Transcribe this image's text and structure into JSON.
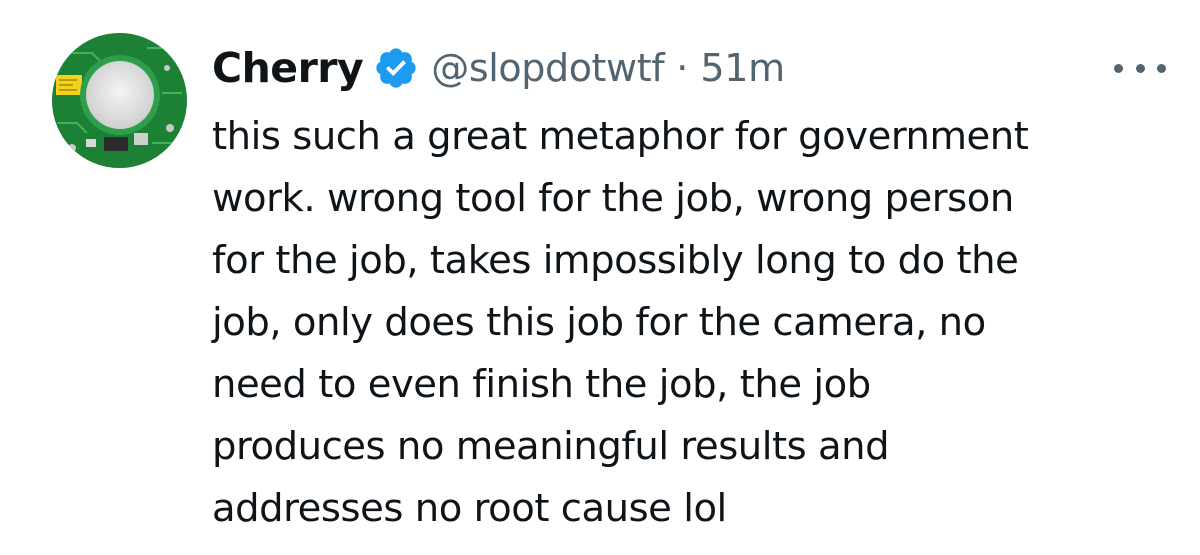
{
  "tweet": {
    "author": {
      "display_name": "Cherry",
      "handle": "@slopdotwtf",
      "verified": true,
      "avatar_icon": "circuit-board-avatar"
    },
    "separator": "·",
    "timestamp": "51m",
    "more_icon": "more-horizontal-icon",
    "text_lines": [
      "this such a great metaphor for government",
      "work. wrong tool for the job, wrong person",
      "for the job, takes impossibly long to do the",
      "job, only does this job for the camera, no",
      "need to even finish the job, the job",
      "produces no meaningful results and",
      "addresses no root cause lol"
    ]
  },
  "colors": {
    "text_primary": "#0f1419",
    "text_secondary": "#536471",
    "verified_blue": "#1d9bf0",
    "avatar_green": "#1f8a3a"
  }
}
